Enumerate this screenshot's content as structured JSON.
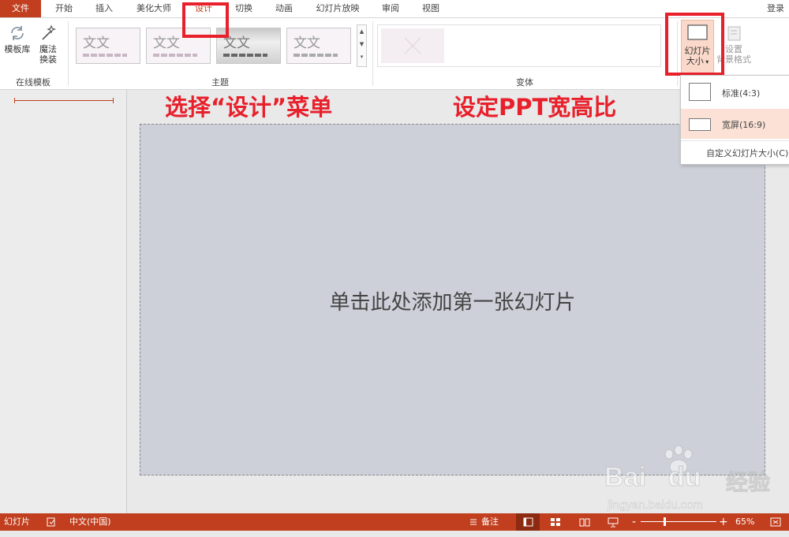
{
  "tabs": {
    "file": "文件",
    "home": "开始",
    "insert": "插入",
    "beautify": "美化大师",
    "design": "设计",
    "transitions": "切换",
    "animations": "动画",
    "slideshow": "幻灯片放映",
    "review": "审阅",
    "view": "视图",
    "login": "登录"
  },
  "ribbon": {
    "template_lib": "模板库",
    "magic_1": "魔法",
    "magic_2": "换装",
    "online_group": "在线模板",
    "theme_group": "主题",
    "theme_sample": "文文",
    "variants_group": "变体",
    "slide_size_1": "幻灯片",
    "slide_size_2": "大小",
    "bg_format_1": "设置",
    "bg_format_2": "背景格式"
  },
  "dropdown": {
    "standard": "标准(4:3)",
    "widescreen": "宽屏(16:9)",
    "custom": "自定义幻灯片大小(C)"
  },
  "annotations": {
    "left": "选择“设计”菜单",
    "right": "设定PPT宽高比"
  },
  "slide": {
    "placeholder": "单击此处添加第一张幻灯片"
  },
  "status": {
    "mode": "幻灯片",
    "language": "中文(中国)",
    "notes": "备注",
    "zoom_minus": "-",
    "zoom_plus": "+",
    "zoom": "65%"
  },
  "watermark": {
    "brand": "Bai",
    "brand2": "du",
    "cn": "经验",
    "url": "jingyan.baidu.com"
  },
  "colors": {
    "accent": "#c13f1e",
    "annotation": "#e8202b"
  }
}
